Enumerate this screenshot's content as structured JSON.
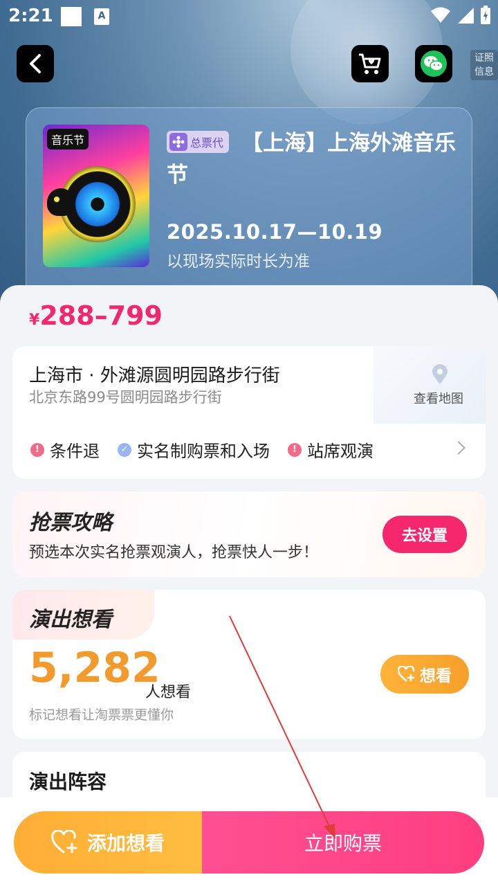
{
  "status_bar": {
    "time": "2:21",
    "app_icon_letter": "A"
  },
  "header": {
    "certificate_info": "证照信息"
  },
  "show": {
    "poster_tag": "音乐节",
    "badge": "总票代",
    "title": "【上海】上海外滩音乐节",
    "date": "2025.10.17—10.19",
    "duration_note": "以现场实际时长为准"
  },
  "price": {
    "currency": "¥",
    "range": "288–799"
  },
  "venue": {
    "name": "上海市 · 外滩源圆明园路步行街",
    "address": "北京东路99号圆明园路步行街",
    "map_label": "查看地图",
    "tags": [
      {
        "label": "条件退",
        "icon": "exclamation-icon",
        "color": "#f16a8a"
      },
      {
        "label": "实名制购票和入场",
        "icon": "check-icon",
        "color": "#9ab6ef"
      },
      {
        "label": "站席观演",
        "icon": "exclamation-icon",
        "color": "#f16a8a"
      }
    ]
  },
  "strategy": {
    "title": "抢票攻略",
    "description": "预选本次实名抢票观演人，抢票快人一步！",
    "button": "去设置"
  },
  "want": {
    "title": "演出想看",
    "count": "5,282",
    "unit": "人想看",
    "subtitle": "标记想看让淘票票更懂你",
    "button": "想看"
  },
  "lineup": {
    "title": "演出阵容"
  },
  "actions": {
    "add_want": "添加想看",
    "buy": "立即购票"
  },
  "colors": {
    "accent_pink": "#f5286e",
    "accent_orange": "#f5a02b",
    "hero_blue": "#3f6a91"
  }
}
